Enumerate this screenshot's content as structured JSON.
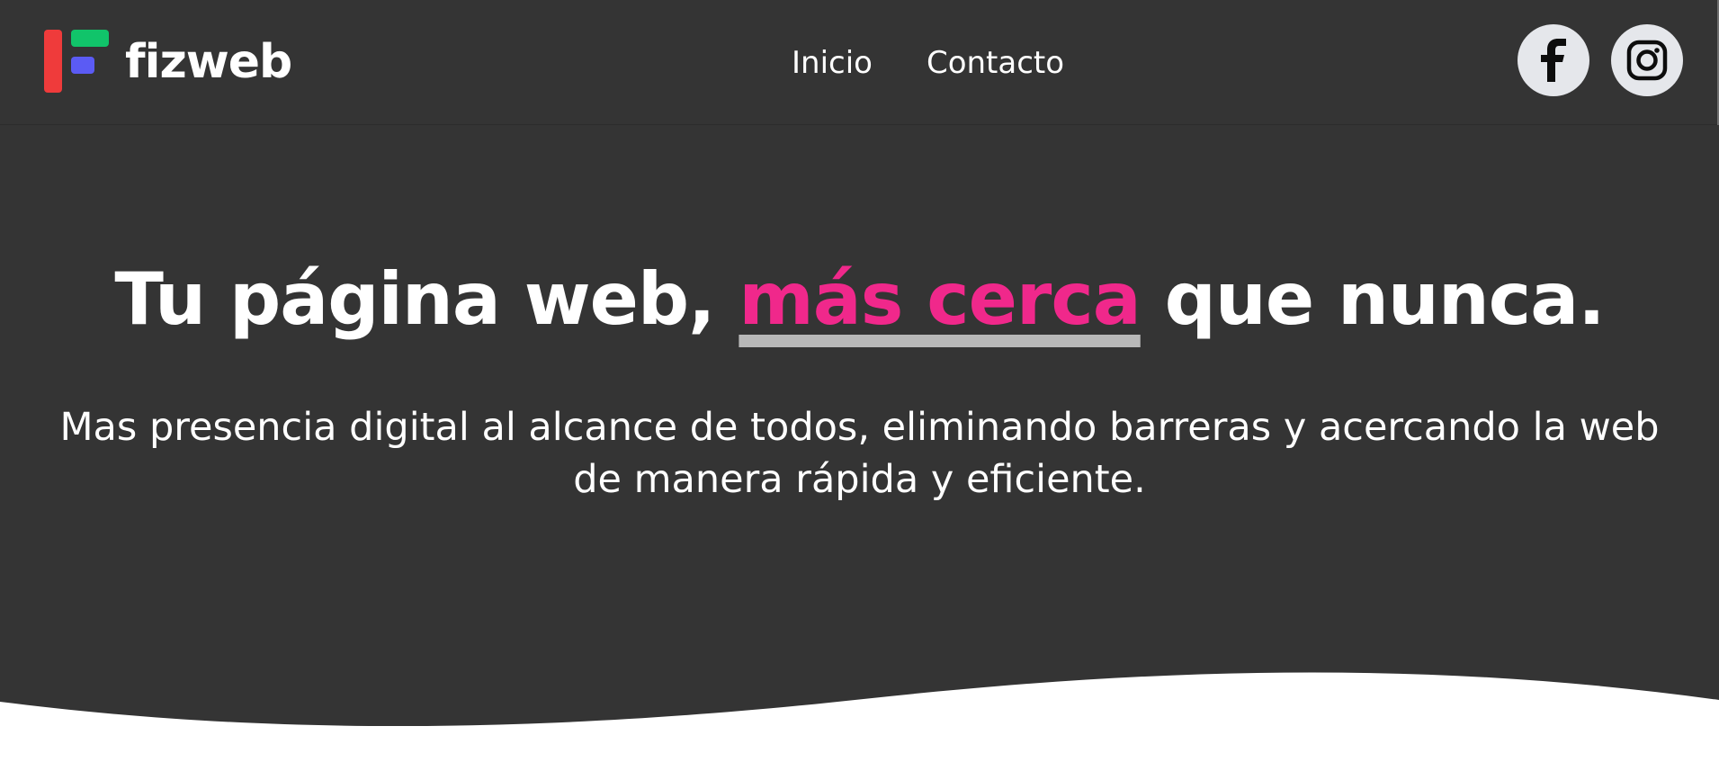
{
  "header": {
    "brand": {
      "name": "fizweb",
      "logo_colors": {
        "bar": "#ef3b3b",
        "top": "#11c46a",
        "middle": "#5b5bf4"
      }
    },
    "nav": [
      {
        "label": "Inicio"
      },
      {
        "label": "Contacto"
      }
    ],
    "social": [
      {
        "icon": "facebook-icon"
      },
      {
        "icon": "instagram-icon"
      }
    ]
  },
  "hero": {
    "headline_before": "Tu página web,",
    "headline_highlight": "más cerca",
    "headline_after": "que nunca.",
    "subtitle": "Mas presencia digital al alcance de todos, eliminando barreras y acercando la web de manera rápida y eficiente."
  },
  "colors": {
    "background_dark": "#343434",
    "accent_pink": "#f0288b",
    "underline_gray": "#b8b8b8",
    "social_button_bg": "#e5e7eb"
  }
}
